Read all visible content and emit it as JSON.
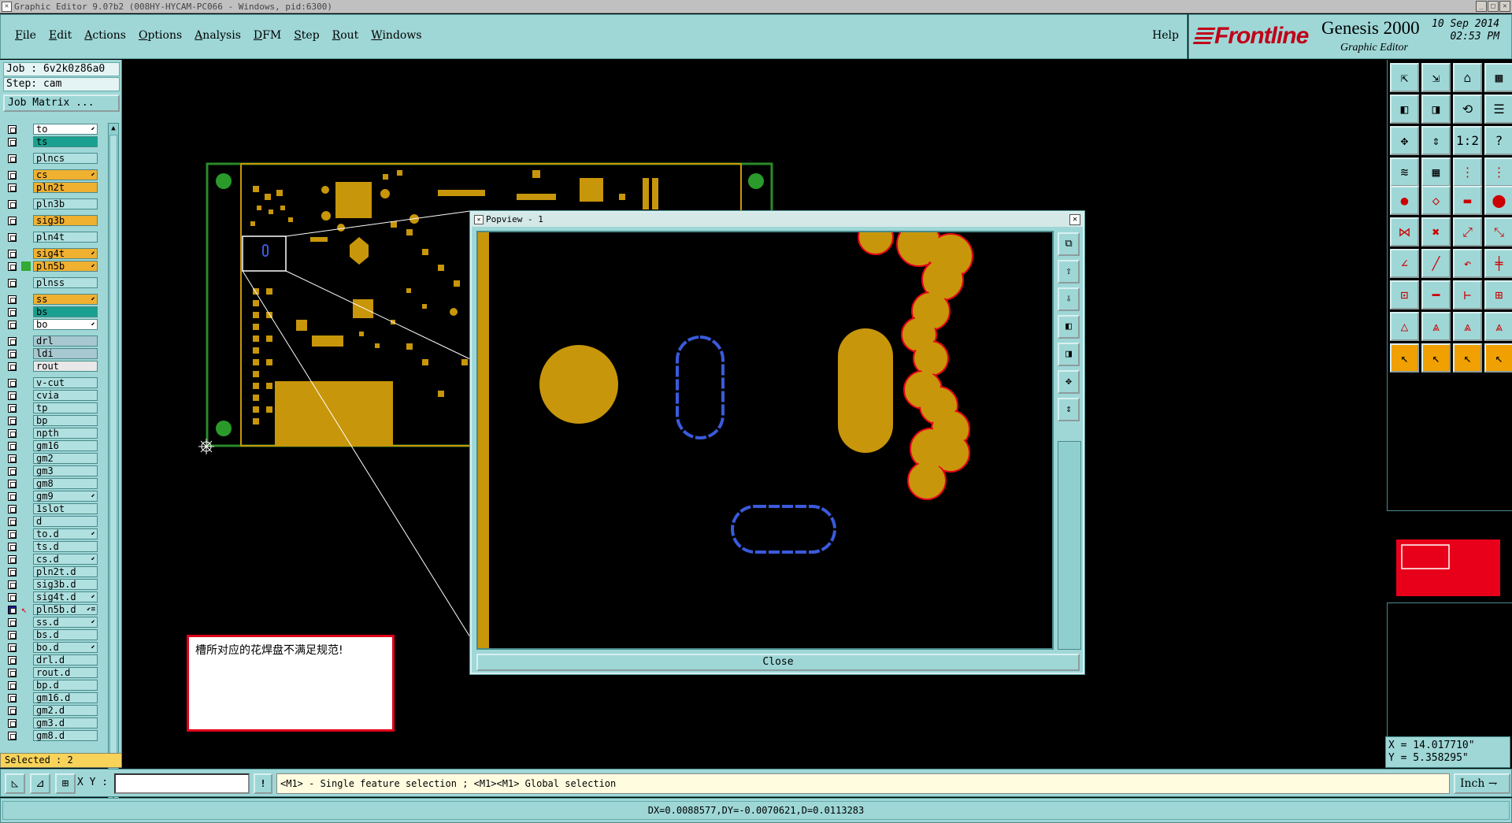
{
  "window": {
    "title": "Graphic Editor 9.0?b2 (008HY-HYCAM-PC066 - Windows, pid:6300)"
  },
  "menu": {
    "items": [
      "File",
      "Edit",
      "Actions",
      "Options",
      "Analysis",
      "DFM",
      "Step",
      "Rout",
      "Windows"
    ],
    "help": "Help"
  },
  "brand": {
    "logo": "Frontline",
    "product": "Genesis 2000",
    "subtitle": "Graphic Editor",
    "date": "10 Sep 2014",
    "time": "02:53 PM"
  },
  "job": {
    "job_line": "Job : 6v2k0z86a0",
    "step_line": "Step: cam",
    "matrix_button": "Job Matrix ..."
  },
  "layers": [
    {
      "name": "to",
      "color": "#ffffff",
      "mark": "⬋"
    },
    {
      "name": "ts",
      "color": "#1aa090",
      "mark": ""
    },
    {
      "name": "plncs",
      "color": "#b0e0e0",
      "mark": "",
      "gap": true
    },
    {
      "name": "cs",
      "color": "#f0b030",
      "mark": "⬋",
      "gap": true
    },
    {
      "name": "pln2t",
      "color": "#f0b030",
      "mark": ""
    },
    {
      "name": "pln3b",
      "color": "#b0e0e0",
      "mark": "",
      "gap": true
    },
    {
      "name": "sig3b",
      "color": "#f0b030",
      "mark": "",
      "gap": true
    },
    {
      "name": "pln4t",
      "color": "#b0e0e0",
      "mark": "",
      "gap": true
    },
    {
      "name": "sig4t",
      "color": "#f0b030",
      "mark": "⬋",
      "gap": true
    },
    {
      "name": "pln5b",
      "color": "#f0b030",
      "mark": "⬋",
      "swatch": "#33aa33"
    },
    {
      "name": "plnss",
      "color": "#b0e0e0",
      "mark": "",
      "gap": true
    },
    {
      "name": "ss",
      "color": "#f0b030",
      "mark": "⬋",
      "gap": true
    },
    {
      "name": "bs",
      "color": "#1aa090",
      "mark": ""
    },
    {
      "name": "bo",
      "color": "#ffffff",
      "mark": "⬋"
    },
    {
      "name": "drl",
      "color": "#a8c8d0",
      "mark": "",
      "gap": true
    },
    {
      "name": "ldi",
      "color": "#a8c8d0",
      "mark": ""
    },
    {
      "name": "rout",
      "color": "#e8e8e8",
      "mark": ""
    },
    {
      "name": "v-cut",
      "color": "#b0e0e0",
      "mark": "",
      "gap": true
    },
    {
      "name": "cvia",
      "color": "#b0e0e0",
      "mark": ""
    },
    {
      "name": "tp",
      "color": "#b0e0e0",
      "mark": ""
    },
    {
      "name": "bp",
      "color": "#b0e0e0",
      "mark": ""
    },
    {
      "name": "npth",
      "color": "#b0e0e0",
      "mark": ""
    },
    {
      "name": "gm16",
      "color": "#b0e0e0",
      "mark": ""
    },
    {
      "name": "gm2",
      "color": "#b0e0e0",
      "mark": ""
    },
    {
      "name": "gm3",
      "color": "#b0e0e0",
      "mark": ""
    },
    {
      "name": "gm8",
      "color": "#b0e0e0",
      "mark": ""
    },
    {
      "name": "gm9",
      "color": "#b0e0e0",
      "mark": "⬋"
    },
    {
      "name": "1slot",
      "color": "#b0e0e0",
      "mark": ""
    },
    {
      "name": "d",
      "color": "#b0e0e0",
      "mark": ""
    },
    {
      "name": "to.d",
      "color": "#b0e0e0",
      "mark": "⬋"
    },
    {
      "name": "ts.d",
      "color": "#b0e0e0",
      "mark": ""
    },
    {
      "name": "cs.d",
      "color": "#b0e0e0",
      "mark": "⬋"
    },
    {
      "name": "pln2t.d",
      "color": "#b0e0e0",
      "mark": ""
    },
    {
      "name": "sig3b.d",
      "color": "#b0e0e0",
      "mark": ""
    },
    {
      "name": "sig4t.d",
      "color": "#b0e0e0",
      "mark": "⬋"
    },
    {
      "name": "pln5b.d",
      "color": "#b0e0e0",
      "mark": "⬋≡",
      "active": true
    },
    {
      "name": "ss.d",
      "color": "#b0e0e0",
      "mark": "⬋"
    },
    {
      "name": "bs.d",
      "color": "#b0e0e0",
      "mark": ""
    },
    {
      "name": "bo.d",
      "color": "#b0e0e0",
      "mark": "⬋"
    },
    {
      "name": "drl.d",
      "color": "#b0e0e0",
      "mark": ""
    },
    {
      "name": "rout.d",
      "color": "#b0e0e0",
      "mark": ""
    },
    {
      "name": "bp.d",
      "color": "#b0e0e0",
      "mark": ""
    },
    {
      "name": "gm16.d",
      "color": "#b0e0e0",
      "mark": ""
    },
    {
      "name": "gm2.d",
      "color": "#b0e0e0",
      "mark": ""
    },
    {
      "name": "gm3.d",
      "color": "#b0e0e0",
      "mark": ""
    },
    {
      "name": "gm8.d",
      "color": "#b0e0e0",
      "mark": ""
    }
  ],
  "selected_text": "Selected : 2",
  "toolbar_icons": [
    [
      "⇱",
      "⇲",
      "⌂",
      "▦"
    ],
    [
      "◧",
      "◨",
      "⟲",
      "☰"
    ],
    [
      "✥",
      "⇕",
      "1:2",
      "?"
    ],
    [
      "≋",
      "▦",
      "⋮",
      "⋮"
    ],
    [
      "●",
      "◇",
      "▬",
      "⬤"
    ],
    [
      "⋈",
      "✖",
      "⤢",
      "⤡"
    ],
    [
      "∠",
      "╱",
      "↶",
      "╪"
    ],
    [
      "⊡",
      "━",
      "⊢",
      "⊞"
    ],
    [
      "△",
      "⩓",
      "⩓",
      "⩓"
    ],
    [
      "↖",
      "↖",
      "↖",
      "↖"
    ]
  ],
  "coords": {
    "x": "X = 14.017710\"",
    "y": "Y = 5.358295\""
  },
  "bottom": {
    "xy_label": "X Y :",
    "xy_value": "",
    "bang": "!",
    "hint": "<M1> - Single feature selection ; <M1><M1> Global selection",
    "units": "Inch"
  },
  "status": "DX=0.0088577,DY=-0.0070621,D=0.0113283",
  "popview": {
    "title": "Popview - 1",
    "close_label": "Close",
    "tools": [
      "⧉",
      "⇧",
      "⇩",
      "◧",
      "◨",
      "✥",
      "⇕"
    ]
  },
  "message": "槽所对应的花焊盘不满足规范!",
  "colors": {
    "panel": "#9fd7d7",
    "pad": "#c8960a",
    "slot": "#3a5bdc",
    "outline": "#e8001a",
    "board": "#2a8a2a"
  }
}
